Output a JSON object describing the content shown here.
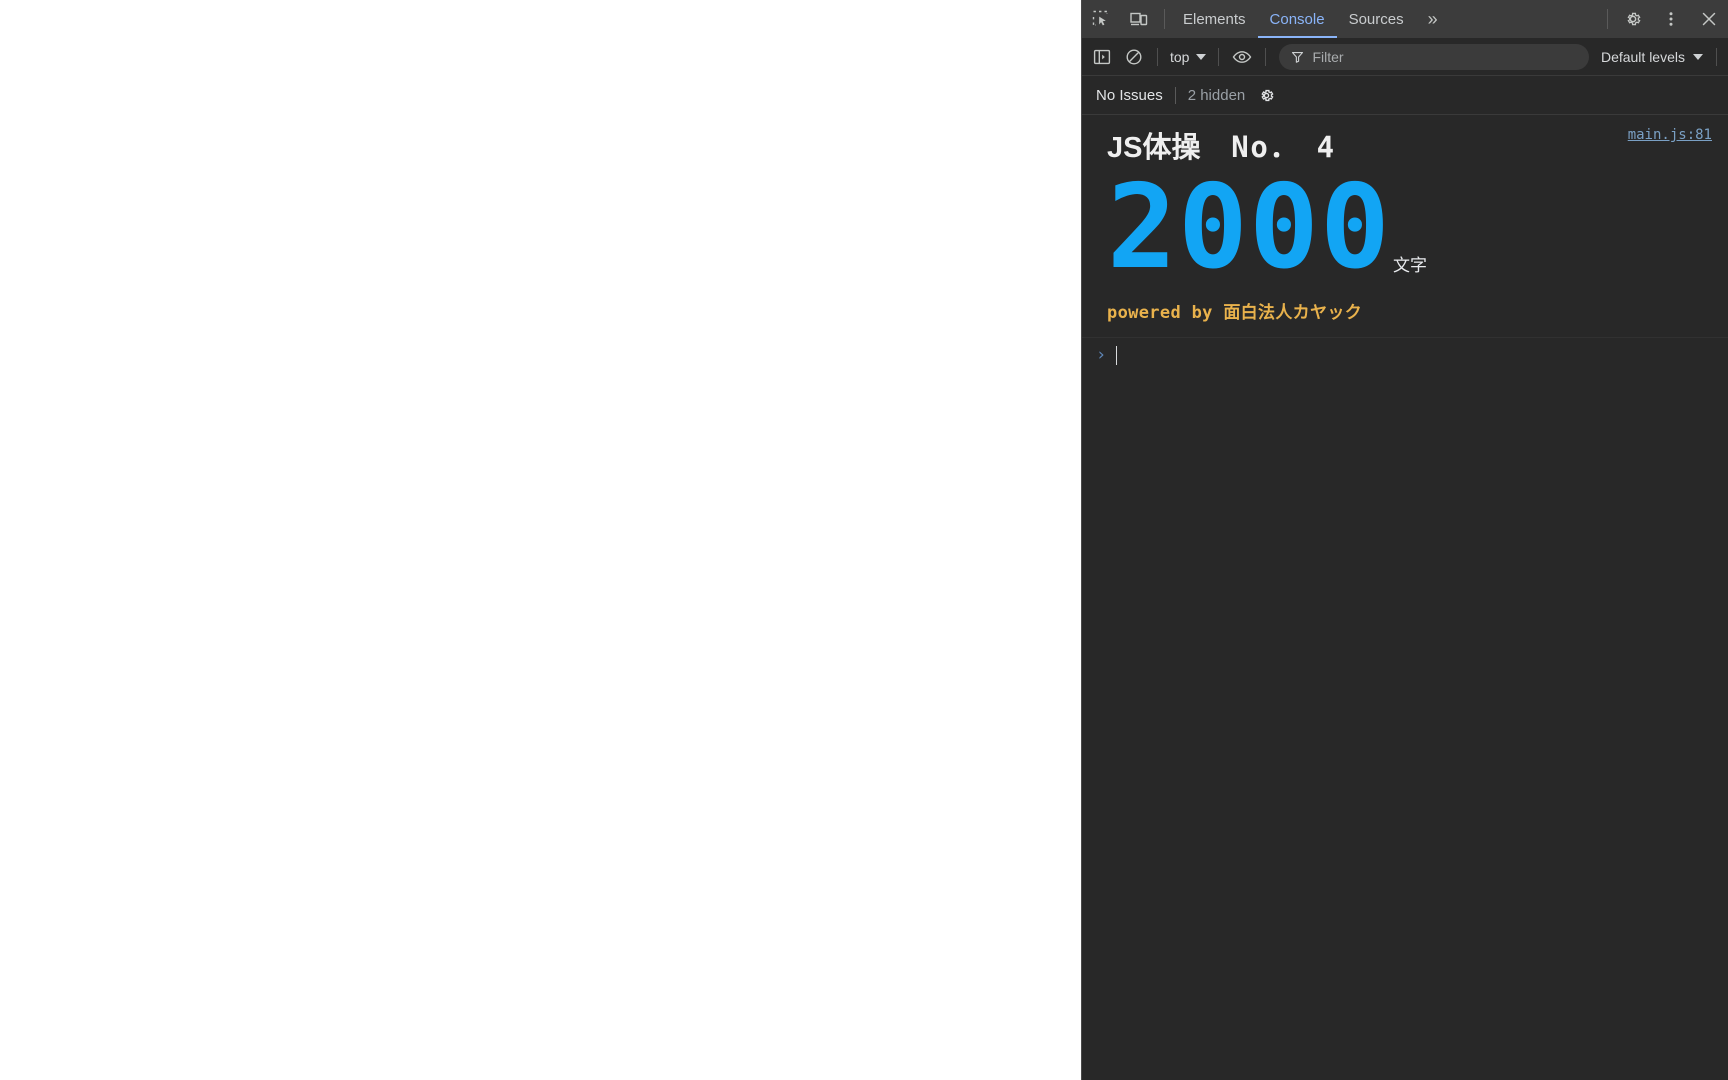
{
  "window": {
    "page_background": "#ffffff",
    "devtools_background": "#282828",
    "accent_blue": "#8ab4f8"
  },
  "devtools": {
    "tabbar": {
      "inspect_icon": "inspect-element-icon",
      "device_icon": "device-toolbar-icon",
      "tabs": [
        {
          "label": "Elements",
          "active": false
        },
        {
          "label": "Console",
          "active": true
        },
        {
          "label": "Sources",
          "active": false
        }
      ],
      "more_tabs_label": "»",
      "settings_icon": "gear-icon",
      "menu_icon": "kebab-menu-icon",
      "close_icon": "close-icon"
    },
    "console_toolbar": {
      "sidebar_icon": "console-sidebar-icon",
      "clear_icon": "clear-console-icon",
      "context_selector": "top",
      "eye_icon": "live-expression-icon",
      "filter": {
        "icon": "filter-funnel-icon",
        "value": "",
        "placeholder": "Filter"
      },
      "levels_label": "Default levels"
    },
    "issues_bar": {
      "issues_label": "No Issues",
      "hidden_label": "2 hidden",
      "settings_icon": "console-settings-gear-icon"
    },
    "console_output": {
      "source_link": "main.js:81",
      "title_prefix": "JS体操",
      "title_number": "　No．　4",
      "big_number": "2000",
      "big_number_unit": "文字",
      "big_number_color": "#12a5f4",
      "powered_by": "powered by 面白法人カヤック",
      "powered_by_color": "#e9b24c",
      "prompt_chevron": "›",
      "prompt_value": ""
    }
  }
}
